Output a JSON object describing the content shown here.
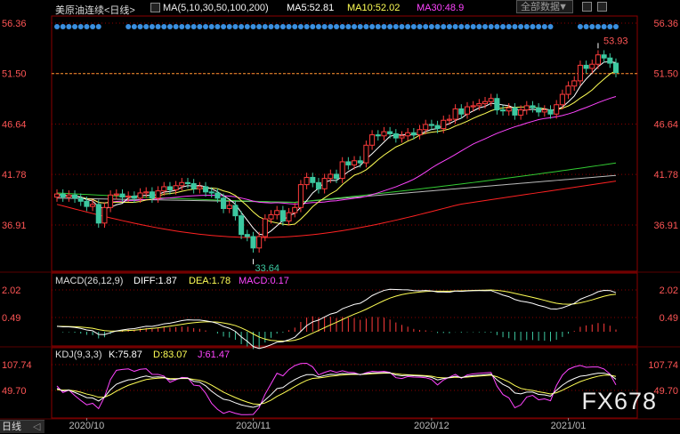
{
  "header": {
    "title": "美原油连续<日线>",
    "ma_settings": "MA(5,10,30,50,100,200)",
    "ma5": "MA5:52.81",
    "ma10": "MA10:52.02",
    "ma30": "MA30:48.9",
    "all_data_button": "全部数据",
    "caret": "▼"
  },
  "macd_header": {
    "title": "MACD(26,12,9)",
    "diff": "DIFF:1.87",
    "dea": "DEA:1.78",
    "macd": "MACD:0.17"
  },
  "kdj_header": {
    "title": "KDJ(9,3,3)",
    "k": "K:75.87",
    "d": "D:83.07",
    "j": "J:61.47"
  },
  "bottom_tab": {
    "label": "日线",
    "arrow": "◁"
  },
  "watermark": "FX678",
  "colors": {
    "up": "#ff3b3b",
    "down": "#3cc8a0",
    "ma5": "#ffffff",
    "ma10": "#ffff55",
    "ma30": "#ff44ff",
    "ma50": "#33cc33",
    "ma100": "#bbbbbb",
    "ma200": "#ff2222",
    "axis_label": "#ff5555",
    "dots": "#3a8fe0",
    "grid": "#8b0000"
  },
  "chart_data": [
    {
      "type": "candlestick",
      "title": "美原油连续<日线>",
      "y_axis_labels": [
        "56.36",
        "51.50",
        "46.64",
        "41.78",
        "36.91"
      ],
      "ylim": [
        32.8,
        56.36
      ],
      "x_axis_labels": [
        "2020/10",
        "2020/11",
        "2020/12",
        "2021/01"
      ],
      "last_price": 51.5,
      "annotations": [
        {
          "label": "53.93",
          "value": 53.93,
          "kind": "high"
        },
        {
          "label": "33.64",
          "value": 33.64,
          "kind": "low"
        }
      ],
      "close": [
        39.9,
        39.6,
        39.8,
        39.5,
        39.2,
        38.7,
        38.9,
        37.1,
        38.6,
        39.8,
        39.9,
        39.6,
        39.7,
        39.5,
        40.0,
        40.1,
        39.5,
        40.2,
        40.6,
        40.3,
        40.7,
        41.0,
        40.9,
        40.4,
        40.6,
        40.1,
        40.0,
        39.5,
        38.5,
        38.8,
        37.8,
        36.0,
        35.8,
        34.7,
        35.8,
        37.5,
        37.9,
        38.3,
        37.3,
        38.1,
        38.6,
        40.8,
        41.5,
        41.0,
        40.4,
        41.4,
        41.8,
        41.4,
        43.0,
        42.7,
        43.1,
        42.9,
        44.6,
        45.6,
        45.5,
        45.9,
        45.7,
        45.3,
        45.5,
        45.8,
        45.6,
        46.1,
        46.6,
        46.5,
        46.2,
        47.0,
        47.1,
        48.1,
        47.6,
        48.3,
        48.4,
        48.6,
        48.8,
        49.1,
        48.0,
        47.9,
        48.2,
        47.5,
        48.0,
        48.4,
        48.2,
        47.8,
        48.0,
        47.6,
        48.5,
        49.5,
        50.3,
        50.8,
        52.3,
        52.0,
        52.4,
        53.3,
        53.0,
        52.5,
        51.6
      ],
      "ma5_last": 52.81,
      "ma10_last": 52.02,
      "ma30_last": 48.9
    },
    {
      "type": "macd",
      "title": "MACD(26,12,9)",
      "y_axis_labels": [
        "2.02",
        "0.49"
      ],
      "series": [
        {
          "name": "DIFF",
          "last": 1.87
        },
        {
          "name": "DEA",
          "last": 1.78
        },
        {
          "name": "MACD",
          "last": 0.17
        }
      ]
    },
    {
      "type": "kdj",
      "title": "KDJ(9,3,3)",
      "y_axis_labels": [
        "107.74",
        "49.70"
      ],
      "series": [
        {
          "name": "K",
          "last": 75.87
        },
        {
          "name": "D",
          "last": 83.07
        },
        {
          "name": "J",
          "last": 61.47
        }
      ]
    }
  ]
}
